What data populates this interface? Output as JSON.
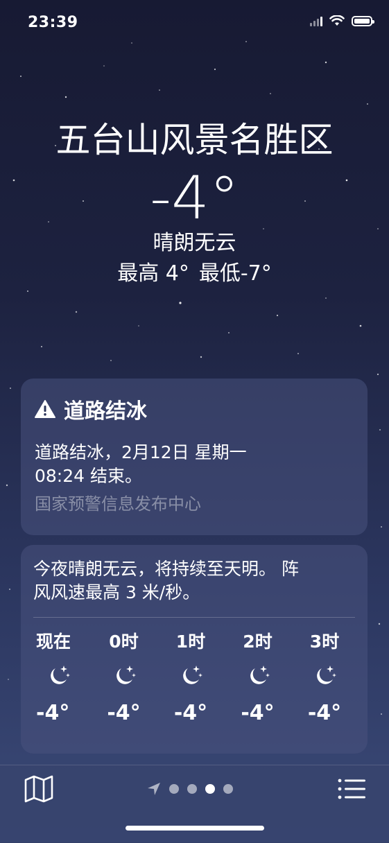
{
  "status_bar": {
    "time": "23:39"
  },
  "location": {
    "city": "五台山风景名胜区",
    "temperature": "-4°",
    "condition": "晴朗无云",
    "high": "最高 4°",
    "low": "最低-7°"
  },
  "alert": {
    "title": "道路结冰",
    "body_line1": "道路结冰，2月12日 星期一",
    "body_line2": "08:24 结束。",
    "source": "国家预警信息发布中心",
    "icon": "warning-triangle-icon"
  },
  "hourly": {
    "summary_line1": "今夜晴朗无云，将持续至天明。 阵",
    "summary_line2": "风风速最高 3 米/秒。",
    "items": [
      {
        "label": "现在",
        "icon": "moon-stars-icon",
        "temp": "-4°"
      },
      {
        "label": "0时",
        "icon": "moon-stars-icon",
        "temp": "-4°"
      },
      {
        "label": "1时",
        "icon": "moon-stars-icon",
        "temp": "-4°"
      },
      {
        "label": "2时",
        "icon": "moon-stars-icon",
        "temp": "-4°"
      },
      {
        "label": "3时",
        "icon": "moon-stars-icon",
        "temp": "-4°"
      }
    ]
  },
  "toolbar": {
    "map_icon": "map-icon",
    "list_icon": "list-icon",
    "location_icon": "location-arrow-icon",
    "page_count": 4,
    "active_page": 3
  }
}
